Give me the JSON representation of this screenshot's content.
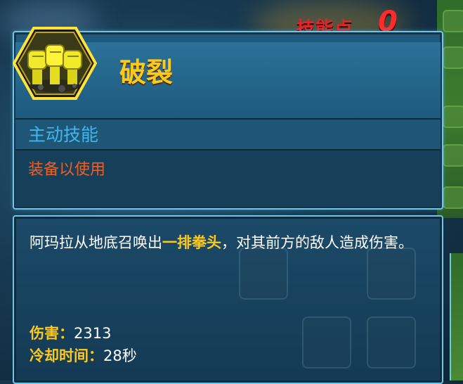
{
  "header": {
    "skill_points_label": "技能点",
    "skill_points_value": "0"
  },
  "skill": {
    "icon": "raised-fists-icon",
    "name": "破裂",
    "type": "主动技能",
    "equip_hint": "装备以使用",
    "description_pre": "阿玛拉从地底召唤出",
    "description_highlight": "一排拳头",
    "description_post": "，对其前方的敌人造成伤害。",
    "stats": [
      {
        "label": "伤害：",
        "value": "2313"
      },
      {
        "label": "冷却时间：",
        "value": "28秒"
      }
    ]
  },
  "colors": {
    "accent_yellow": "#ffc91a",
    "skill_points_red": "#e0262a",
    "type_blue": "#3fb6f0",
    "equip_orange": "#ee5f26",
    "panel_border": "#6fc6e6"
  }
}
